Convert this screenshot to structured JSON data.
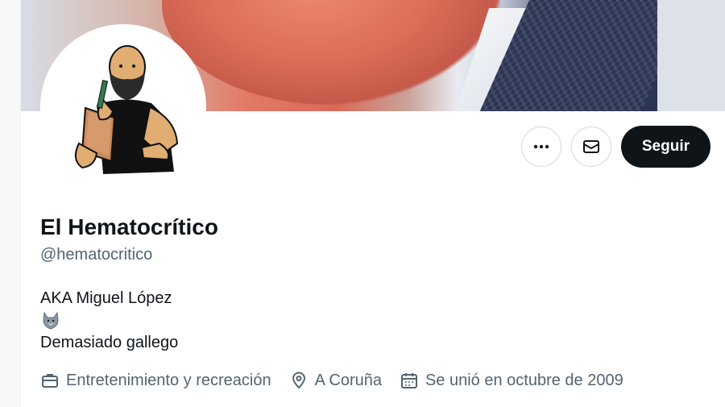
{
  "profile": {
    "name": "El Hematocrítico",
    "handle": "@hematocritico",
    "bio_line1": "AKA Miguel López",
    "bio_emoji": "wolf-emoji",
    "bio_line3": "Demasiado gallego"
  },
  "actions": {
    "more_icon": "more-icon",
    "message_icon": "mail-icon",
    "follow_label": "Seguir"
  },
  "meta": {
    "category": "Entretenimiento y recreación",
    "location": "A Coruña",
    "joined": "Se unió en octubre de 2009"
  },
  "colors": {
    "text_primary": "#0f1419",
    "text_secondary": "#536471",
    "button_dark": "#0f1419",
    "border": "#cfd9de"
  }
}
